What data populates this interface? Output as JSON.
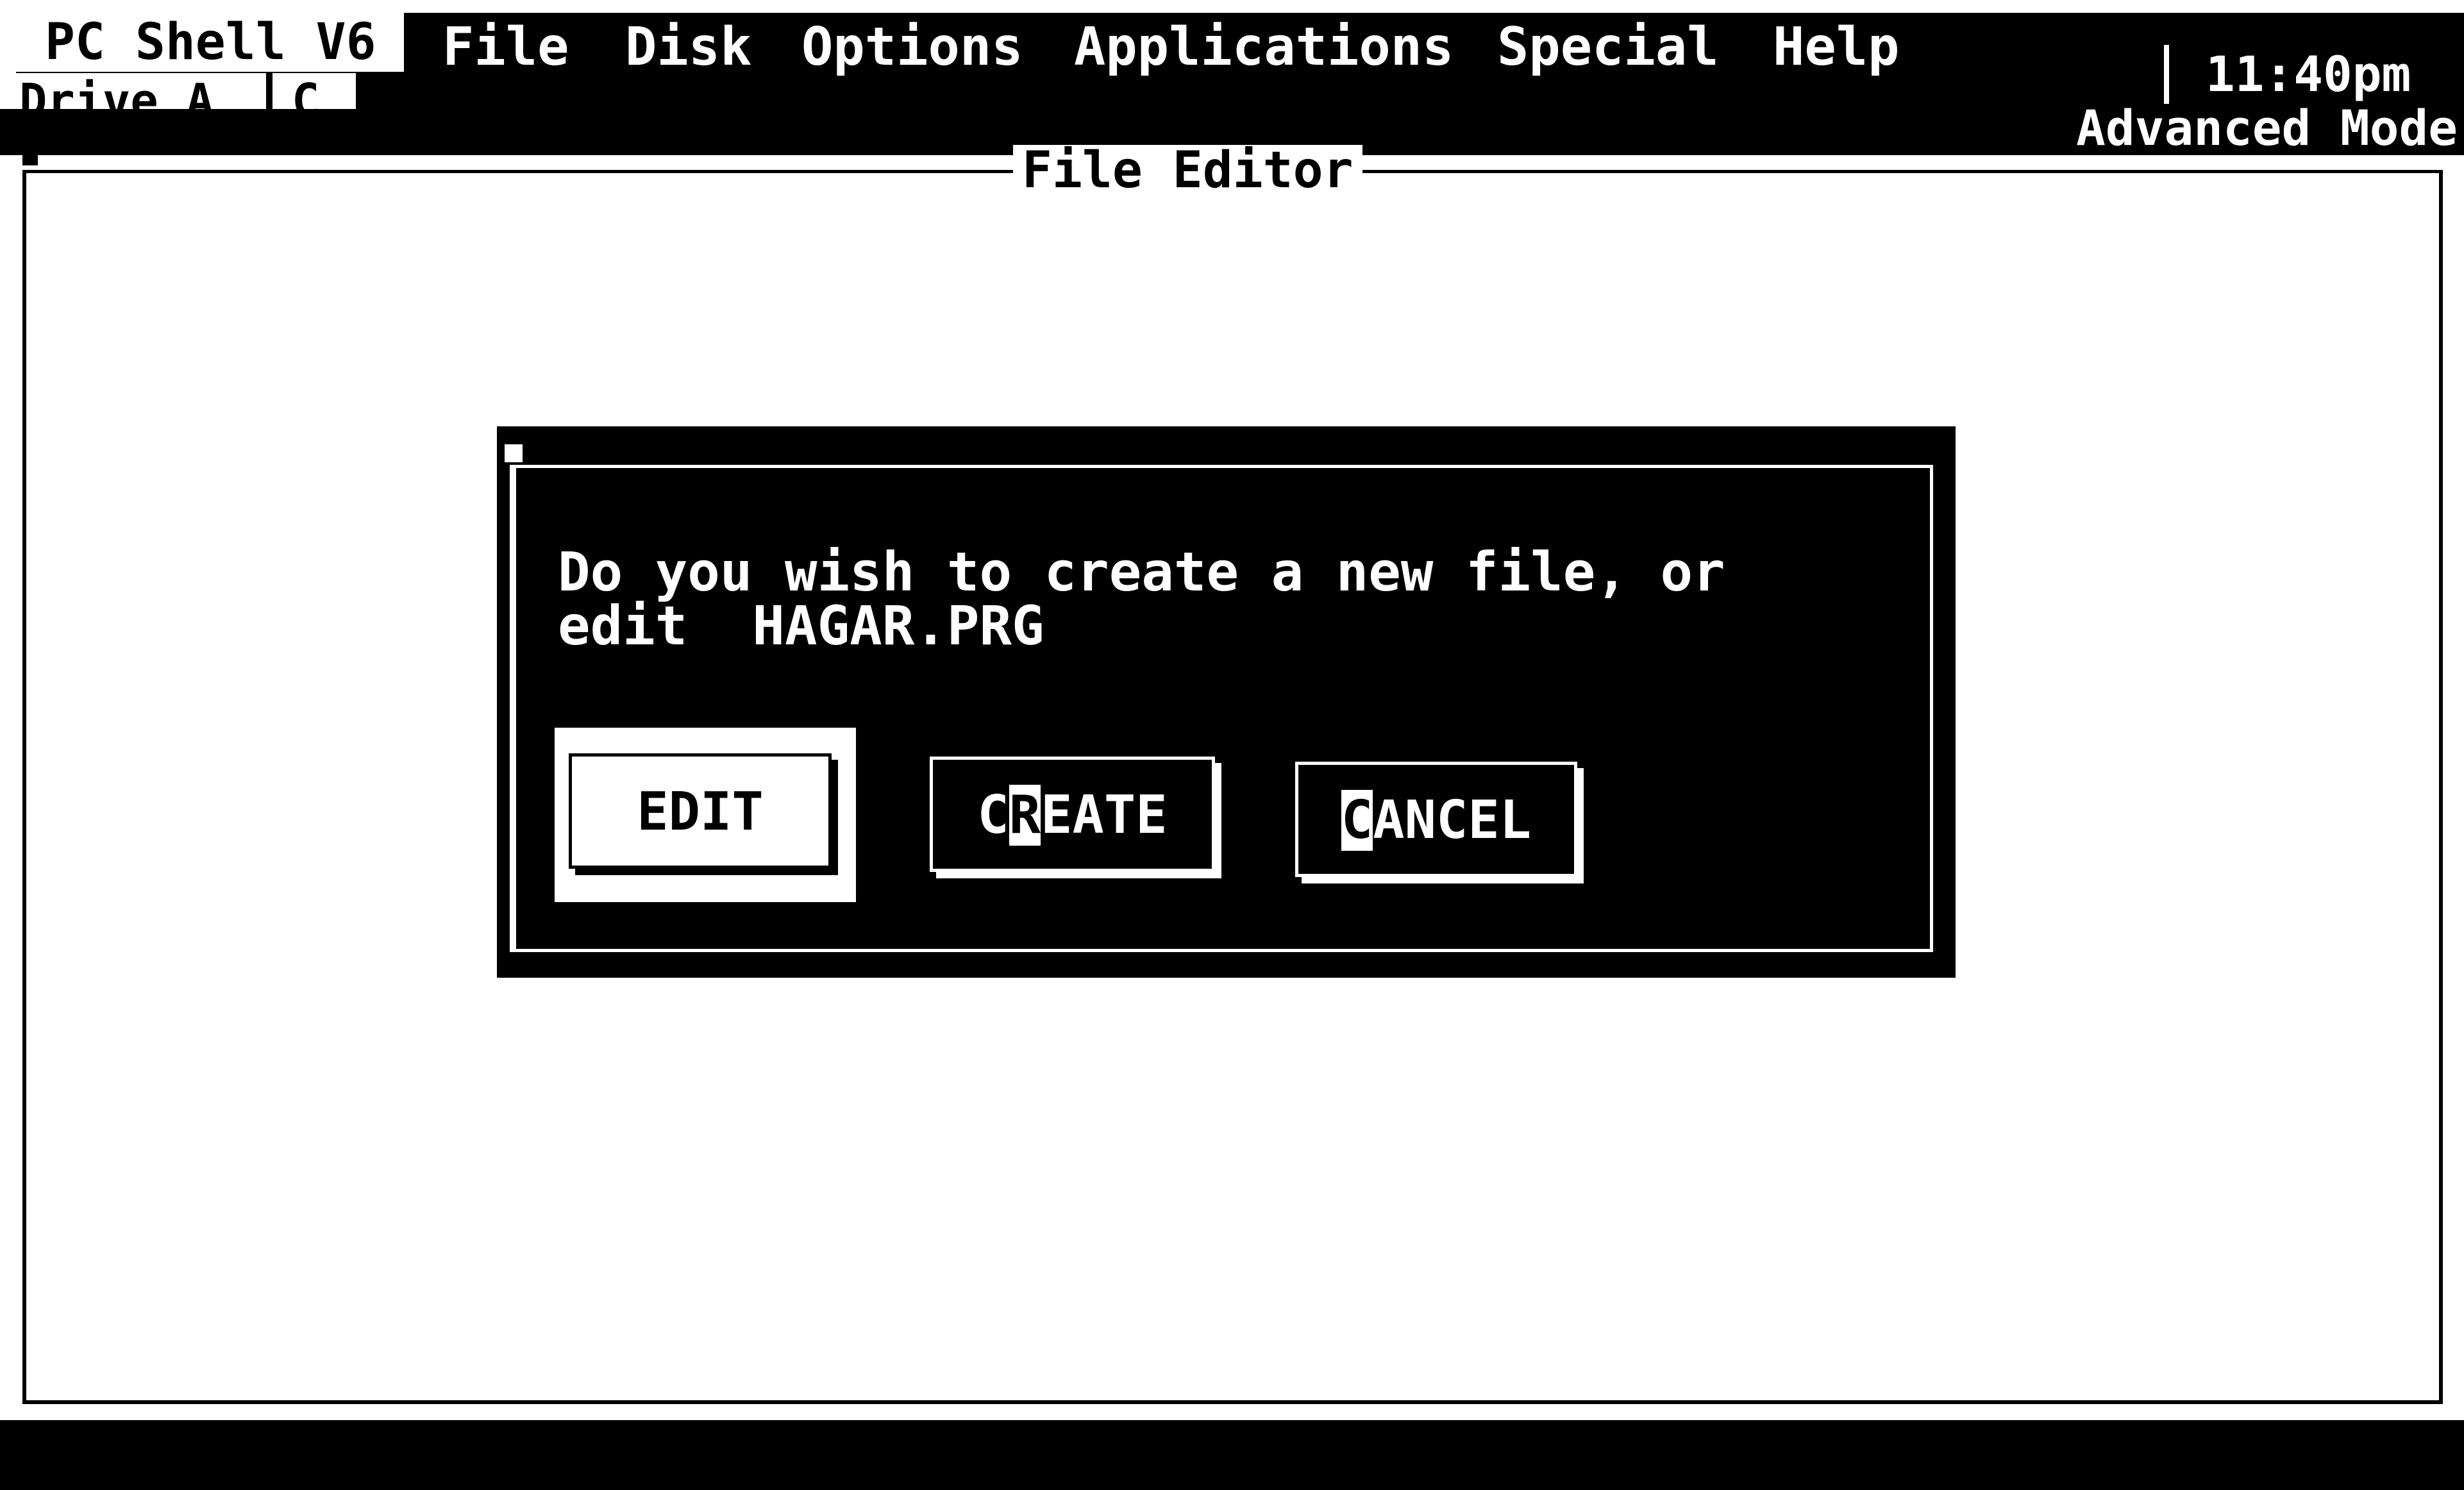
{
  "app": {
    "title": "PC Shell V6"
  },
  "menu": {
    "items": [
      "File",
      "Disk",
      "Options",
      "Applications",
      "Special",
      "Help"
    ]
  },
  "drive": {
    "label": "Drive A",
    "letter": "C"
  },
  "status": {
    "time": "11:40pm",
    "mode": "Advanced Mode"
  },
  "editor": {
    "title": "File Editor"
  },
  "dialog": {
    "line1": "Do you wish to create a new file, or",
    "line2": "edit  HAGAR.PRG",
    "buttons": {
      "edit": "EDIT",
      "create": {
        "prefix": "C",
        "hotkey": "R",
        "suffix": "EATE"
      },
      "cancel": {
        "prefix": "",
        "hotkey": "C",
        "suffix": "ANCEL"
      }
    }
  },
  "colors": {
    "background": "#ffffff",
    "foreground": "#000000"
  }
}
